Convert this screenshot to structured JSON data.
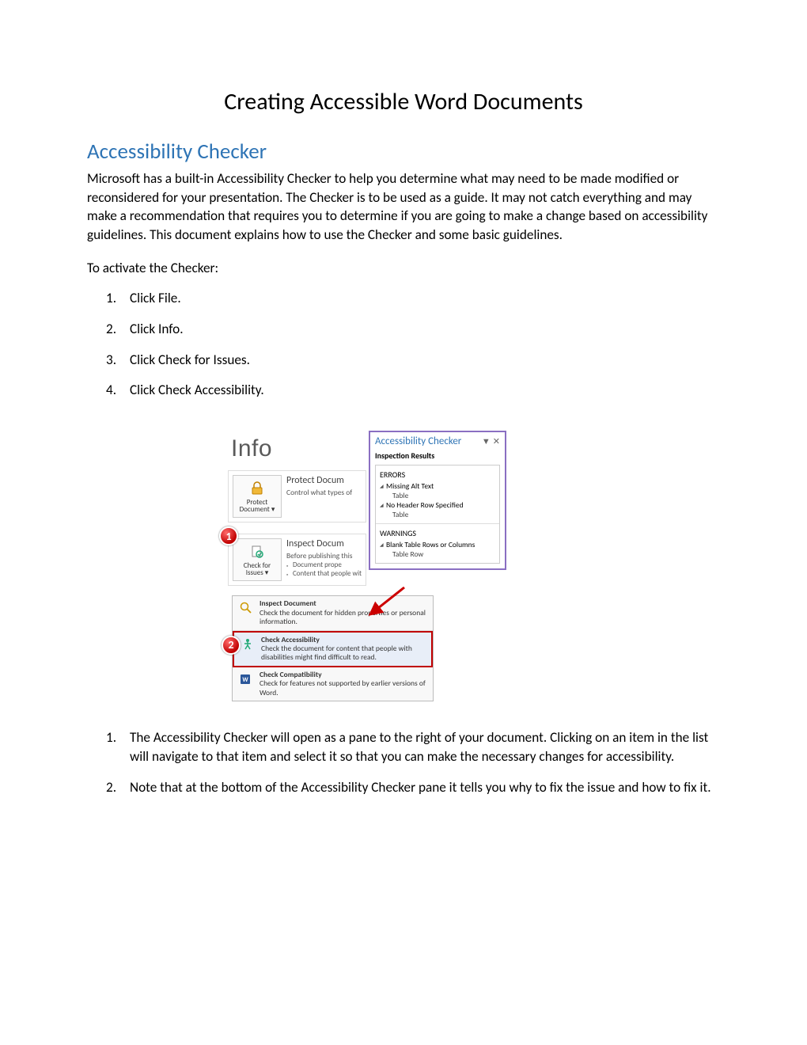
{
  "title": "Creating Accessible Word Documents",
  "section_heading": "Accessibility Checker",
  "intro_paragraph": "Microsoft has a built-in Accessibility Checker to help you determine what may need to be made modified or reconsidered for your presentation. The Checker is to be used as a guide. It may not catch everything and may make a recommendation that requires you to determine if you are going to make a change based on accessibility guidelines. This document explains how to use the Checker and some basic guidelines.",
  "activate_line": "To activate the Checker:",
  "steps": {
    "s1": "Click File.",
    "s2": "Click Info.",
    "s3": "Click Check for Issues.",
    "s4": "Click Check Accessibility."
  },
  "figure": {
    "info_label": "Info",
    "protect": {
      "button_top": "Protect",
      "button_bottom": "Document ▾",
      "title": "Protect Docum",
      "sub": "Control what types of"
    },
    "check": {
      "button_top": "Check for",
      "button_bottom": "Issues ▾",
      "title": "Inspect Docum",
      "sub": "Before publishing this",
      "b1": "Document prope",
      "b2": "Content that people with disabilit"
    },
    "dropdown": {
      "inspect_t": "Inspect Document",
      "inspect_d": "Check the document for hidden properties or personal information.",
      "access_t": "Check Accessibility",
      "access_d": "Check the document for content that people with disabilities might find difficult to read.",
      "compat_t": "Check Compatibility",
      "compat_d": "Check for features not supported by earlier versions of Word."
    },
    "pane": {
      "title": "Accessibility Checker",
      "subtitle": "Inspection Results",
      "errors": "ERRORS",
      "e1": "Missing Alt Text",
      "e1s": "Table",
      "e2": "No Header Row Specified",
      "e2s": "Table",
      "warnings": "WARNINGS",
      "w1": "Blank Table Rows or Columns",
      "w1s": "Table Row"
    },
    "badge1": "1",
    "badge2": "2"
  },
  "notes": {
    "n1": "The Accessibility Checker will open as a pane to the right of your document. Clicking on an item in the list will navigate to that item and select it so that you can make the necessary changes for accessibility.",
    "n2": "Note that at the bottom of the Accessibility Checker pane it tells you why to fix the issue and how to fix it."
  }
}
